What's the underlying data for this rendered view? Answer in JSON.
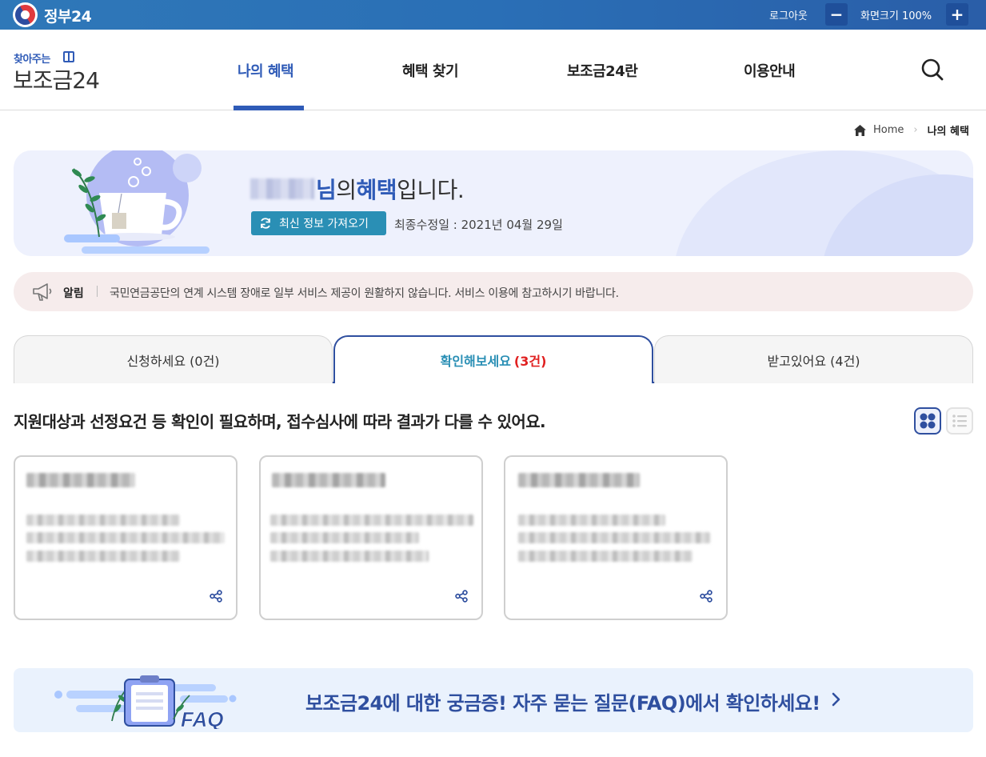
{
  "topbar": {
    "site_title": "정부24",
    "logout_label": "로그아웃",
    "zoom_minus": "−",
    "zoom_label": "화면크기 100%",
    "zoom_plus": "+"
  },
  "header": {
    "brand_small": "찾아주는",
    "brand_big": "보조금24",
    "nav": [
      "나의 혜택",
      "혜택 찾기",
      "보조금24란",
      "이용안내"
    ],
    "active_nav_index": 0
  },
  "breadcrumb": {
    "home": "Home",
    "current": "나의 혜택"
  },
  "hero": {
    "name_suffix": "님",
    "greeting_mid": "의 ",
    "greeting_bold": "혜택",
    "greeting_end": "입니다.",
    "refresh_label": "최신 정보 가져오기",
    "last_modified": "최종수정일 : 2021년 04월 29일"
  },
  "notice": {
    "label": "알림",
    "text": "국민연금공단의 연계 시스템 장애로 일부 서비스 제공이 원활하지 않습니다. 서비스 이용에 참고하시기 바랍니다."
  },
  "tabs": [
    {
      "label": "신청하세요",
      "count": "(0건)"
    },
    {
      "label": "확인해보세요",
      "count": "(3건)"
    },
    {
      "label": "받고있어요",
      "count": "(4건)"
    }
  ],
  "active_tab_index": 1,
  "description": "지원대상과 선정요건 등 확인이 필요하며, 접수심사에 따라 결과가 다를 수 있어요.",
  "faq": {
    "badge": "FAQ",
    "text": "보조금24에 대한 궁금증! 자주 묻는 질문(FAQ)에서 확인하세요!"
  },
  "colors": {
    "topbar": "#2a6fb6",
    "brand_blue": "#2f5bb7",
    "teal": "#2a8fb5",
    "count_red": "#e02020",
    "notice_bg": "#f6ecec",
    "hero_bg": "#eef1fd"
  },
  "icons": [
    "gov-emblem-icon",
    "gift-icon",
    "search-icon",
    "home-icon",
    "refresh-icon",
    "megaphone-icon",
    "grid-view-icon",
    "list-view-icon",
    "share-icon",
    "chevron-right-icon"
  ]
}
